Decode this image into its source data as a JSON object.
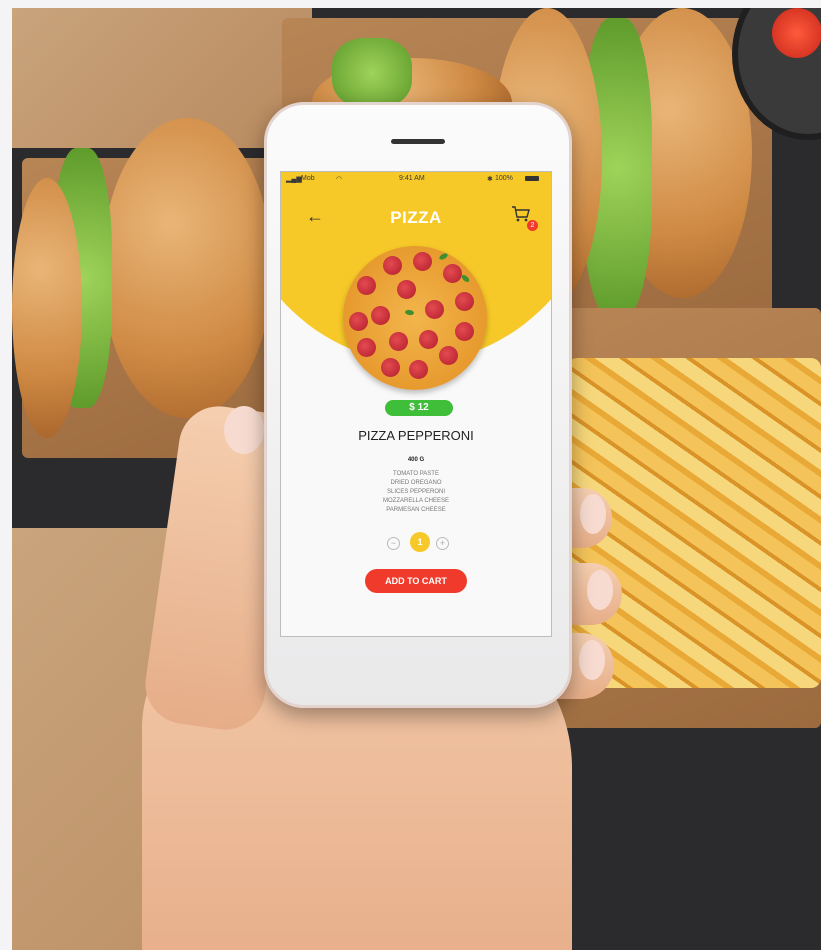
{
  "status_bar": {
    "carrier": "Mob",
    "time": "9:41 AM",
    "battery": "100%"
  },
  "app": {
    "title": "PIZZA",
    "back_icon": "arrow-left-icon",
    "cart_icon": "shopping-cart-icon",
    "cart_count": "2"
  },
  "product": {
    "price": "$ 12",
    "name": "PIZZA PEPPERONI",
    "weight": "400 G",
    "ingredients": [
      "TOMATO PASTE",
      "DRIED OREGANO",
      "SLICES PEPPERONI",
      "MOZZARELLA CHEESE",
      "PARMESAN CHEESE"
    ]
  },
  "quantity": {
    "minus": "−",
    "value": "1",
    "plus": "+"
  },
  "actions": {
    "add_to_cart": "ADD TO CART"
  },
  "colors": {
    "accent_yellow": "#f7c928",
    "price_green": "#3fbf39",
    "cta_red": "#f03a2b"
  }
}
